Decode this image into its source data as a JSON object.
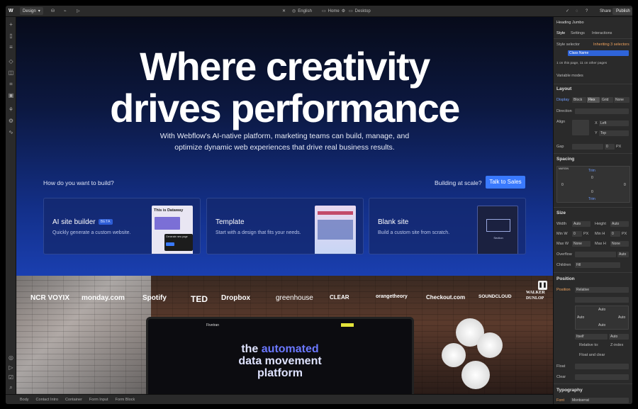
{
  "topbar": {
    "logo": "W",
    "mode": "Design",
    "locale": "English",
    "page": "Home",
    "breakpoint": "Desktop",
    "share": "Share",
    "publish": "Publish"
  },
  "hero": {
    "line1": "Where creativity",
    "line2": "drives performance",
    "subtitle_line1": "With Webflow's AI-native platform, marketing teams can build, manage, and",
    "subtitle_line2": "optimize dynamic web experiences that drive real business results.",
    "question": "How do you want to build?",
    "scale": "Building at scale?",
    "sales_button": "Talk to Sales"
  },
  "cards": [
    {
      "title": "AI site builder",
      "badge": "BETA",
      "desc": "Quickly generate a custom website.",
      "thumb_headline": "This is Dataway",
      "thumb_prompt": "Generate new page"
    },
    {
      "title": "Template",
      "desc": "Start with a design that fits your needs."
    },
    {
      "title": "Blank site",
      "desc": "Build a custom site from scratch.",
      "thumb_label": "Section"
    }
  ],
  "logos": [
    "NCR VOYIX",
    "monday.com",
    "Spotify",
    "TED",
    "Dropbox",
    "greenhouse",
    "CLEAR",
    "orangetheory",
    "Checkout.com",
    "SOUNDCLOUD",
    "WALKER DUNLOP"
  ],
  "monitor": {
    "brand": "Fivetran",
    "line1a": "the",
    "line1b": "automated",
    "line2": "data movement",
    "line3": "platform"
  },
  "breadcrumbs": [
    "Body",
    "Contact Intro",
    "Container",
    "Form Input",
    "Form Block"
  ],
  "panel": {
    "element": "Heading Jumbo",
    "tabs": [
      "Style",
      "Settings",
      "Interactions"
    ],
    "style_selector": "Style selector",
    "inheriting": "Inheriting 3 selectors",
    "class_name": "Class Name",
    "pages_info": "1 on this page, 11 on other pages",
    "variable_modes": "Variable modes",
    "layout": "Layout",
    "display": "Display",
    "display_options": [
      "Block",
      "Flex",
      "Grid",
      "None"
    ],
    "direction": "Direction",
    "align": "Align",
    "x_label": "X",
    "x_value": "Left",
    "y_label": "Y",
    "y_value": "Top",
    "gap": "Gap",
    "gap_value": "0",
    "gap_unit": "PX",
    "spacing": "Spacing",
    "margin_label": "MARGIN",
    "spacing_values": [
      "0",
      "0",
      "0",
      "0"
    ],
    "top_badge": "Trim",
    "bottom_badge": "Trim",
    "size": "Size",
    "width": "Width",
    "height": "Height",
    "auto": "Auto",
    "min_w": "Min W",
    "min_h": "Min H",
    "max_w": "Max W",
    "max_h": "Max H",
    "none": "None",
    "min_val": "0",
    "min_unit": "PX",
    "overflow": "Overflow",
    "children": "Children",
    "children_val": "Fill",
    "position": "Position",
    "position_label": "Position",
    "position_val": "Relative",
    "itself": "Itself",
    "relative_to": "Relative to:",
    "zindex": "Z-index",
    "float_clear": "Float and clear",
    "float": "Float",
    "clear": "Clear",
    "typography": "Typography",
    "font": "Font",
    "font_val": "Montserrat"
  },
  "colors": {
    "accent": "#3a7afe",
    "panel": "#2a2a2a",
    "orange": "#f0a35e"
  }
}
